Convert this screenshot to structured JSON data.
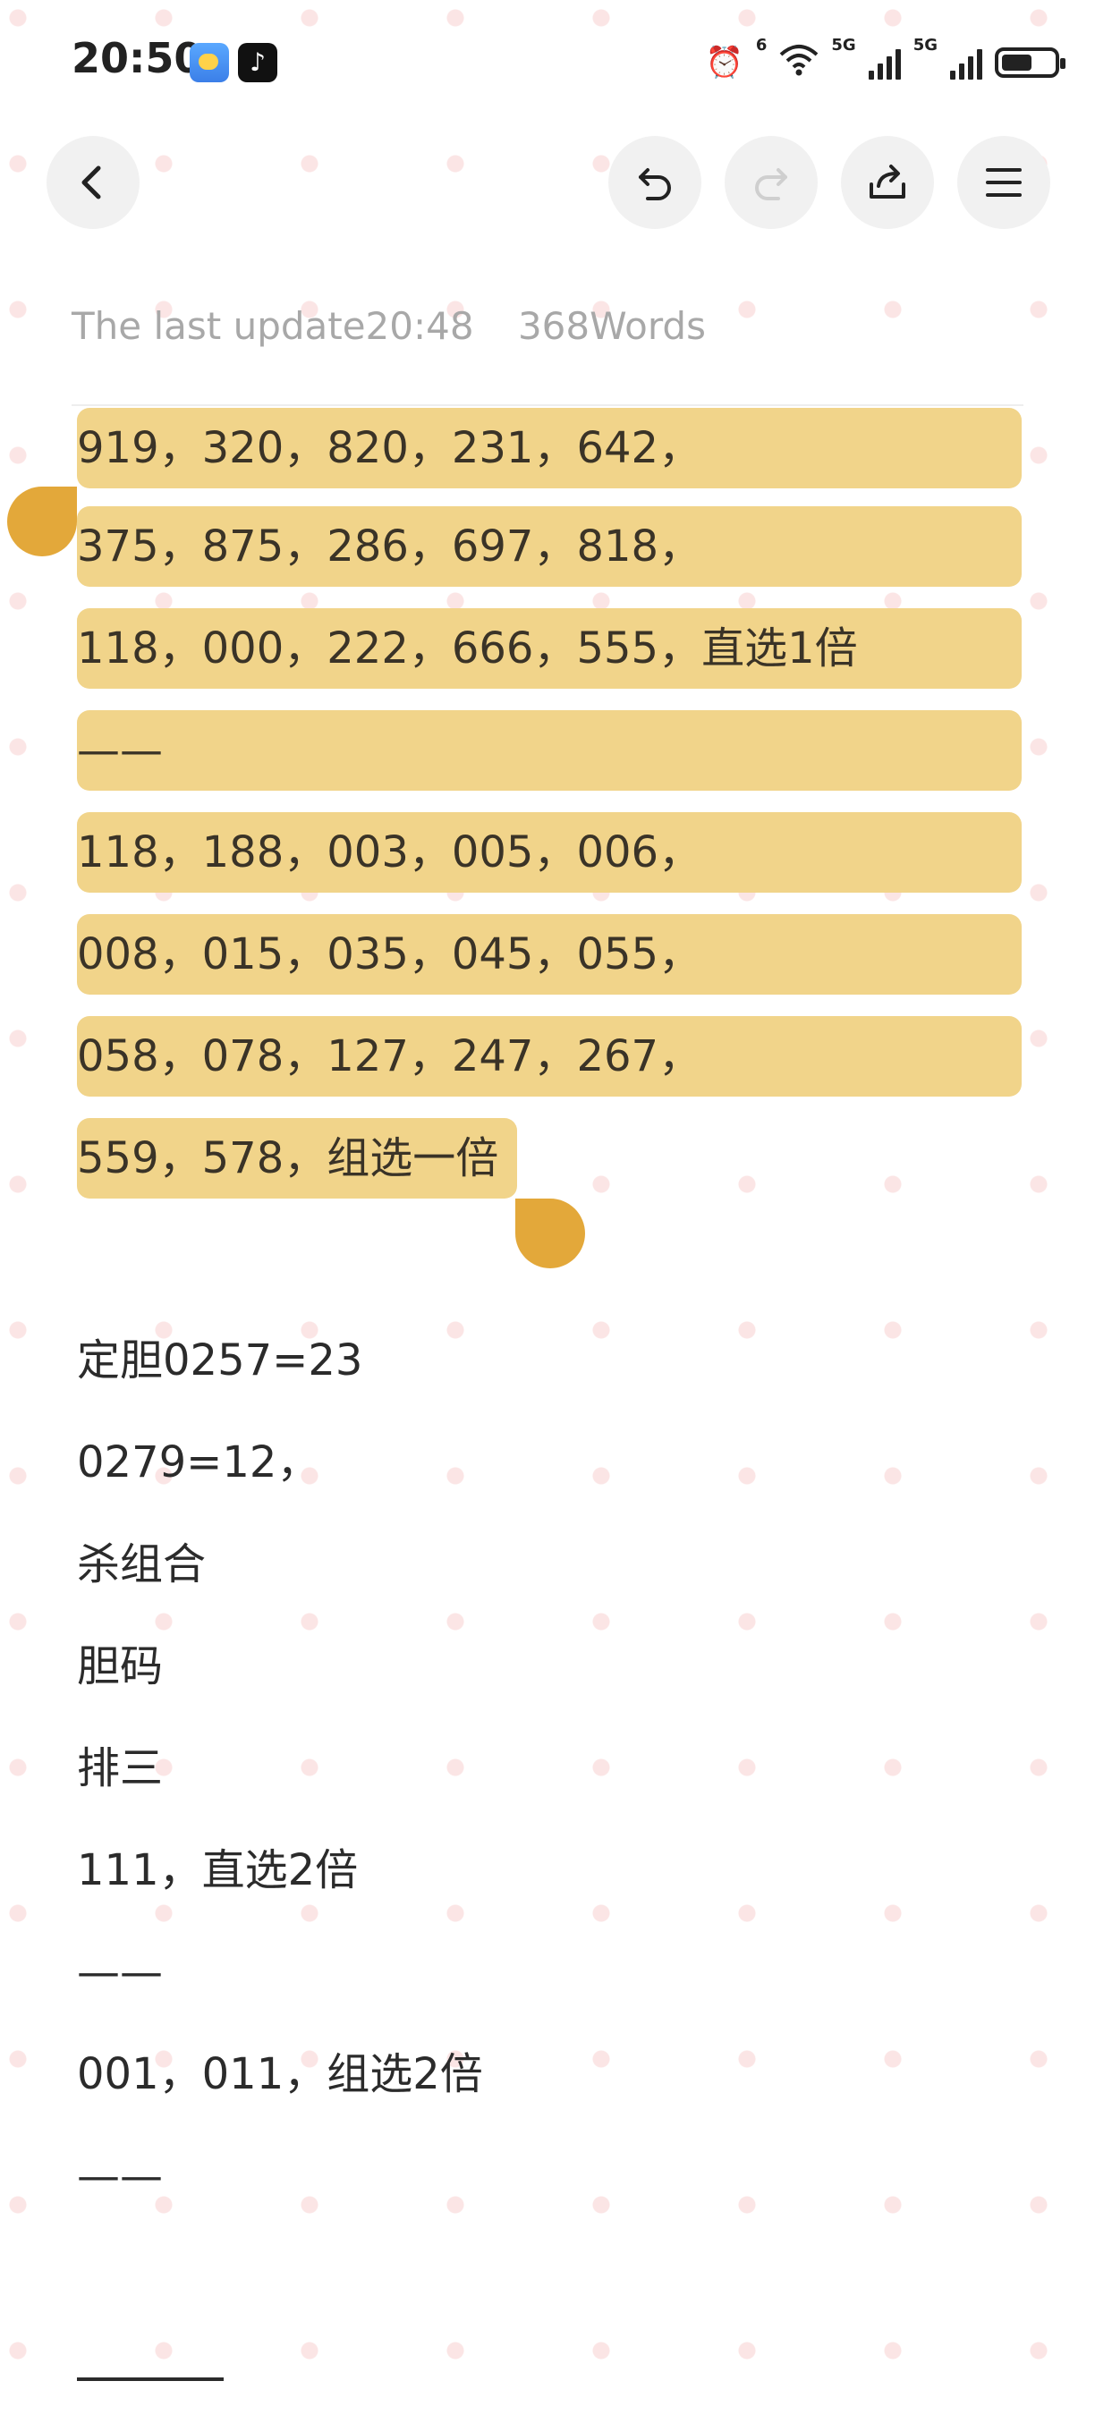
{
  "status_bar": {
    "time": "20:50",
    "icons": [
      "weather-app-icon",
      "tiktok-app-icon",
      "alarm-icon",
      "wifi-icon",
      "signal-5g-icon",
      "signal-5g-icon",
      "battery-icon"
    ],
    "wifi_badge": "6",
    "network_1": "5G",
    "network_2": "5G"
  },
  "toolbar": {
    "back_icon": "back-icon",
    "undo_icon": "undo-icon",
    "redo_icon": "redo-icon",
    "share_icon": "share-icon",
    "menu_icon": "menu-icon"
  },
  "meta": {
    "last_update": "The last update20:48",
    "word_count": "368Words"
  },
  "note": {
    "highlighted_lines": [
      "919，320，820，231，642，",
      "375，875，286，697，818，",
      "118，000，222，666，555，直选1倍",
      "——",
      "118，188，003，005，006，",
      "008，015，035，045，055，",
      "058，078，127，247，267，",
      "559，578，组选一倍"
    ],
    "lines": [
      "定胆0257=23",
      "0279=12，",
      "杀组合",
      "胆码",
      "排三",
      "111，直选2倍",
      "——",
      "001，011，组选2倍",
      "——"
    ]
  },
  "colors": {
    "highlight": "#f1d48a",
    "handle": "#e3a83a",
    "meta_text": "#a8a8a8"
  }
}
